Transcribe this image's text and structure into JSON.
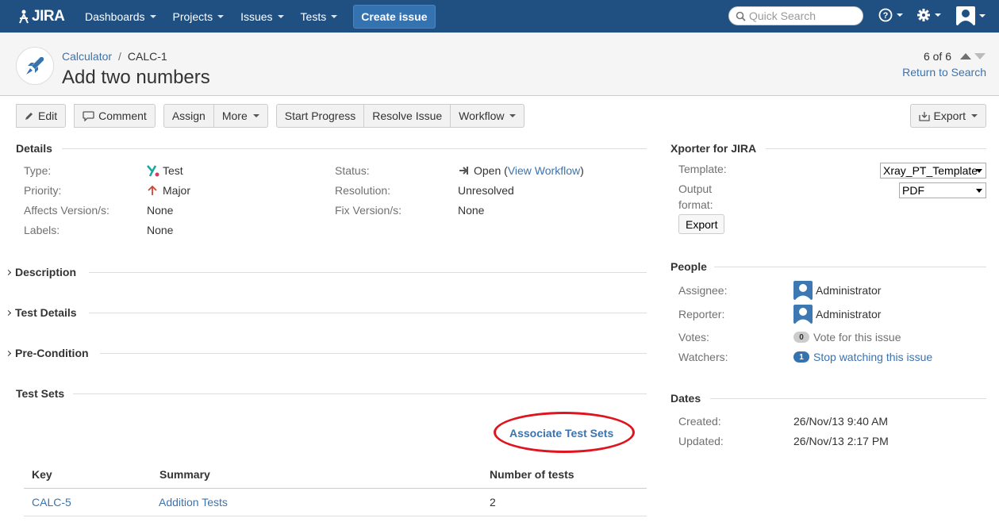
{
  "nav": {
    "logo": "JIRA",
    "items": [
      "Dashboards",
      "Projects",
      "Issues",
      "Tests"
    ],
    "create": "Create issue",
    "search_placeholder": "Quick Search"
  },
  "header": {
    "project": "Calculator",
    "separator": "/",
    "issue_key": "CALC-1",
    "title": "Add two numbers",
    "pager": "6 of 6",
    "return": "Return to Search"
  },
  "toolbar": {
    "edit": "Edit",
    "comment": "Comment",
    "assign": "Assign",
    "more": "More",
    "start_progress": "Start Progress",
    "resolve": "Resolve Issue",
    "workflow": "Workflow",
    "export": "Export"
  },
  "details": {
    "title": "Details",
    "type_label": "Type:",
    "type_value": "Test",
    "priority_label": "Priority:",
    "priority_value": "Major",
    "affects_label": "Affects Version/s:",
    "affects_value": "None",
    "labels_label": "Labels:",
    "labels_value": "None",
    "status_label": "Status:",
    "status_value": "Open",
    "status_open_paren": "(",
    "status_link": "View Workflow",
    "status_close_paren": ")",
    "resolution_label": "Resolution:",
    "resolution_value": "Unresolved",
    "fix_label": "Fix Version/s:",
    "fix_value": "None"
  },
  "sections": {
    "description": "Description",
    "test_details": "Test Details",
    "precondition": "Pre-Condition",
    "test_sets": "Test Sets"
  },
  "test_sets": {
    "associate": "Associate Test Sets",
    "columns": [
      "Key",
      "Summary",
      "Number of tests"
    ],
    "rows": [
      {
        "key": "CALC-5",
        "summary": "Addition Tests",
        "count": "2"
      }
    ]
  },
  "xporter": {
    "title": "Xporter for JIRA",
    "template_label": "Template:",
    "template_value": "Xray_PT_Template",
    "output_label_1": "Output",
    "output_label_2": "format:",
    "output_value": "PDF",
    "export": "Export"
  },
  "people": {
    "title": "People",
    "assignee_label": "Assignee:",
    "assignee": "Administrator",
    "reporter_label": "Reporter:",
    "reporter": "Administrator",
    "votes_label": "Votes:",
    "votes_count": "0",
    "votes_text": "Vote for this issue",
    "watchers_label": "Watchers:",
    "watchers_count": "1",
    "watchers_text": "Stop watching this issue"
  },
  "dates": {
    "title": "Dates",
    "created_label": "Created:",
    "created": "26/Nov/13 9:40 AM",
    "updated_label": "Updated:",
    "updated": "26/Nov/13 2:17 PM"
  },
  "colors": {
    "nav_bg": "#205081",
    "link": "#3b73af",
    "highlight": "#e0141e"
  }
}
